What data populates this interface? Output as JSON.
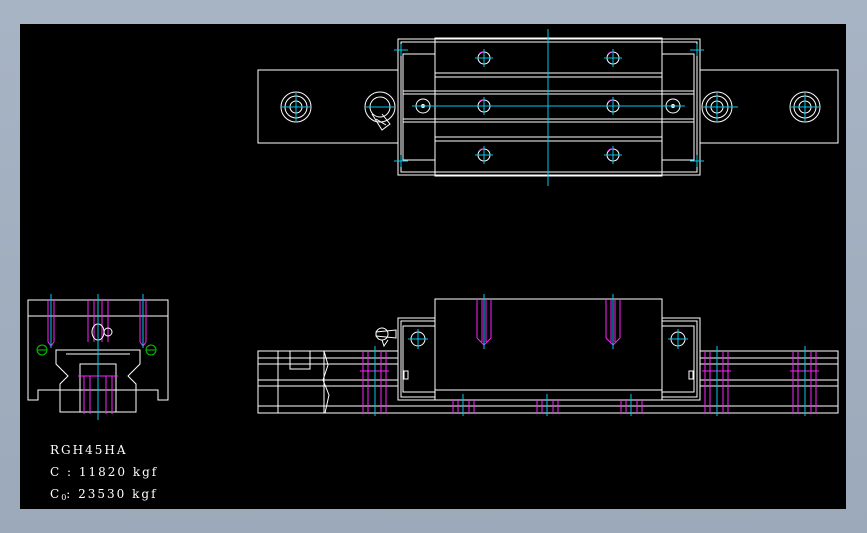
{
  "specs": {
    "model": "RGH45HA",
    "dynamic_load": "C : 11820 kgf",
    "static_load_symbol": "C",
    "static_load_subscript": "0",
    "static_load_value": ": 23530 kgf"
  },
  "colors": {
    "background": "#000000",
    "outline": "#ffffff",
    "centerline": "#00c8e8",
    "hidden": "#ff22ff",
    "bolt_circle": "#00cc00",
    "viewport_frame": "#a7b4c4"
  }
}
